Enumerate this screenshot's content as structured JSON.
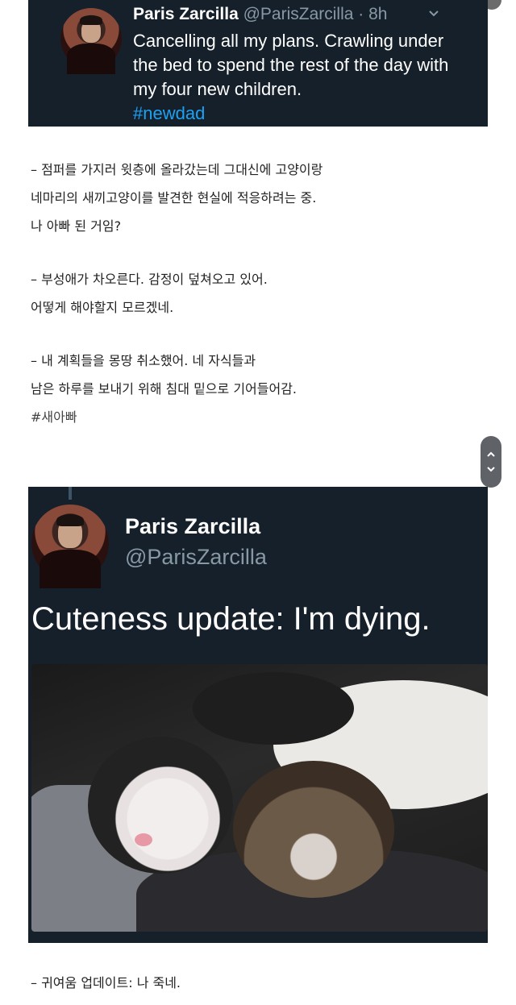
{
  "tweet1": {
    "name": "Paris Zarcilla",
    "handle": "@ParisZarcilla",
    "time": "· 8h",
    "text": "Cancelling all my plans. Crawling under the bed to spend the rest of the day with my four new children.",
    "hashtag": "#newdad"
  },
  "translation": {
    "block1": [
      "– 점퍼를 가지러 윗층에 올라갔는데 그대신에 고양이랑",
      "네마리의 새끼고양이를 발견한 현실에 적응하려는 중.",
      "나 아빠 된 거임?"
    ],
    "block2": [
      "– 부성애가 차오른다. 감정이 덮쳐오고 있어.",
      "어떻게 해야할지 모르겠네."
    ],
    "block3": [
      "– 내 계획들을 몽땅 취소했어. 네 자식들과",
      "남은 하루를 보내기 위해 침대 밑으로 기어들어감.",
      "#새아빠"
    ]
  },
  "tweet2": {
    "name": "Paris Zarcilla",
    "handle": "@ParisZarcilla",
    "text": "Cuteness update: I'm dying."
  },
  "caption": "– 귀여움 업데이트: 나 죽네.",
  "icons": {
    "menu": "chevron-down-icon",
    "scroll_up": "chevron-up-icon",
    "scroll_down": "chevron-down-icon"
  },
  "colors": {
    "card_bg": "#15202b",
    "handle": "#8899a6",
    "hashtag": "#1da1f2"
  }
}
